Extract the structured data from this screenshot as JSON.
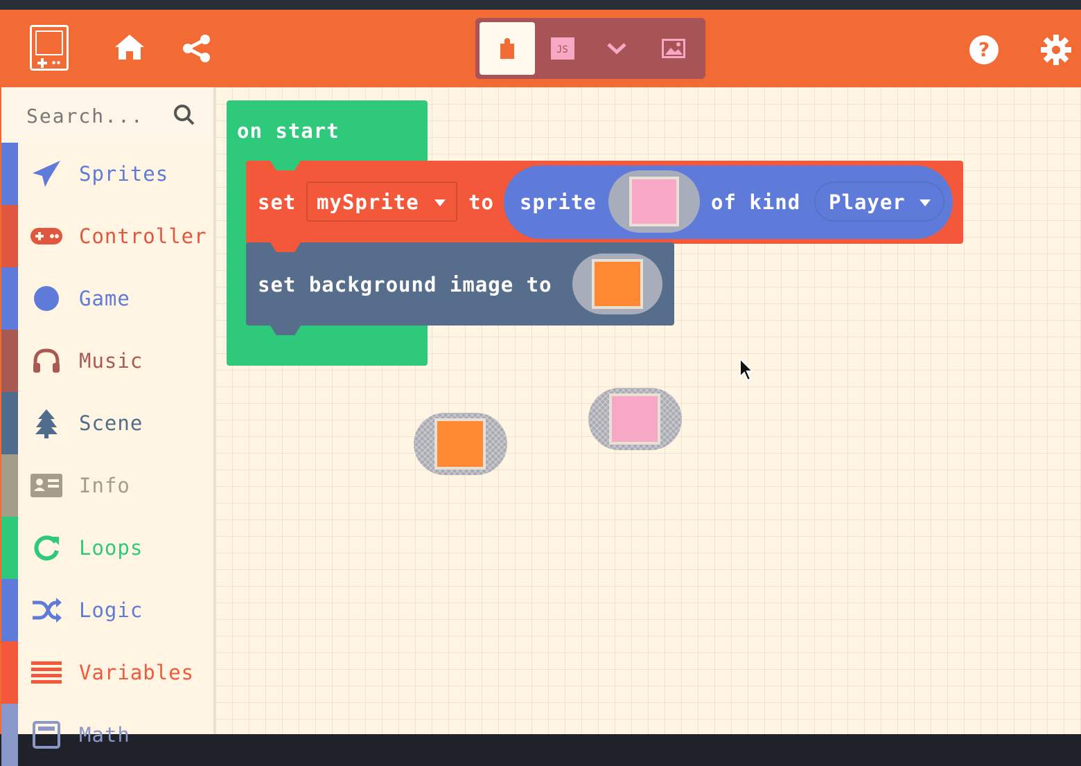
{
  "header": {
    "editor_modes": [
      "blocks",
      "javascript",
      "more",
      "assets"
    ],
    "js_label": "JS",
    "colors": {
      "header": "#f26b35",
      "toggle": "#a85456"
    }
  },
  "sidebar": {
    "search_placeholder": "Search...",
    "categories": [
      {
        "label": "Sprites",
        "color": "#5e7bd9",
        "icon": "paper-plane-icon"
      },
      {
        "label": "Controller",
        "color": "#e0563f",
        "icon": "gamepad-icon"
      },
      {
        "label": "Game",
        "color": "#5e7bd9",
        "icon": "circle-icon"
      },
      {
        "label": "Music",
        "color": "#a85a52",
        "icon": "headphones-icon"
      },
      {
        "label": "Scene",
        "color": "#4f6c8c",
        "icon": "tree-icon"
      },
      {
        "label": "Info",
        "color": "#a39d8a",
        "icon": "id-card-icon"
      },
      {
        "label": "Loops",
        "color": "#2ec97b",
        "icon": "refresh-icon"
      },
      {
        "label": "Logic",
        "color": "#5e7bd9",
        "icon": "shuffle-icon"
      },
      {
        "label": "Variables",
        "color": "#f4583a",
        "icon": "list-icon"
      },
      {
        "label": "Math",
        "color": "#8a97c9",
        "icon": "calculator-icon"
      }
    ]
  },
  "workspace": {
    "on_start_label": "on start",
    "set_label": "set",
    "variable_name": "mySprite",
    "to_label": "to",
    "sprite_label": "sprite",
    "of_kind_label": "of kind",
    "kind_value": "Player",
    "set_background_label": "set background image to",
    "colors": {
      "on_start": "#2ec97b",
      "set_block": "#f4583a",
      "sprite_block": "#5e7bd9",
      "background_block": "#566e8c",
      "sprite_image": "#f6a8c4",
      "background_image": "#ff8833"
    }
  }
}
